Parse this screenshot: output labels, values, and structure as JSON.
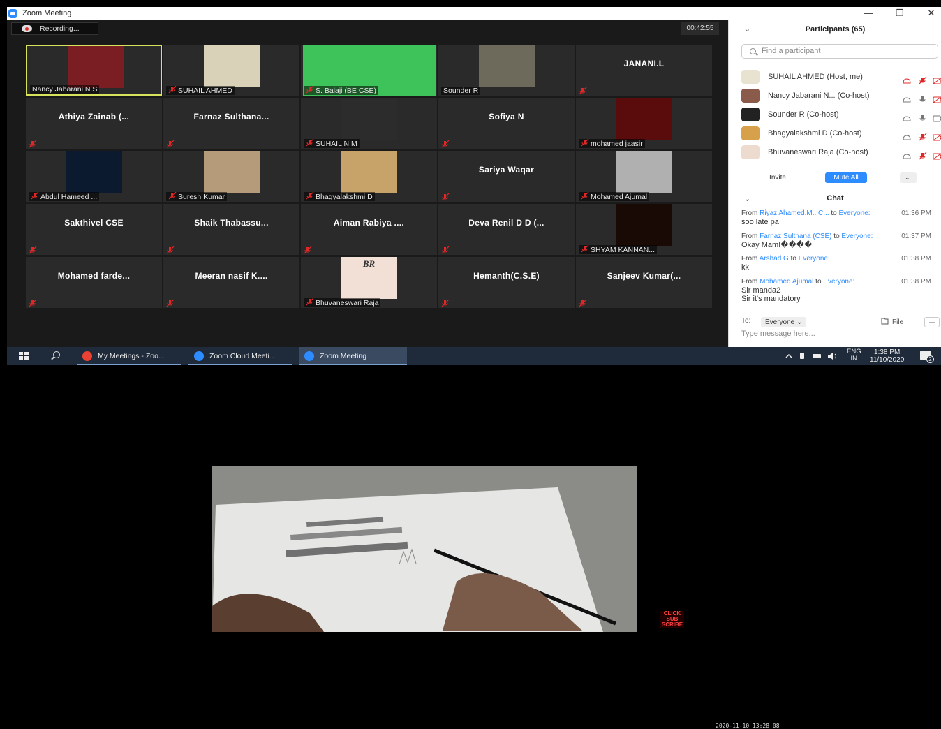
{
  "window": {
    "title": "Zoom Meeting",
    "minimize": "—",
    "restore": "❐",
    "close": "✕"
  },
  "meeting": {
    "recording_label": "Recording...",
    "timer": "00:42:55"
  },
  "tiles": [
    {
      "text": "Nancy Jabarani N S",
      "has_photo": true,
      "muted": false,
      "active": true
    },
    {
      "text": "SUHAIL AHMED",
      "has_photo": true,
      "muted": true
    },
    {
      "text": "S. Balaji (BE CSE)",
      "has_photo": true,
      "muted": true
    },
    {
      "text": "Sounder R",
      "has_photo": true,
      "muted": false
    },
    {
      "text": "JANANI.L",
      "has_photo": false,
      "muted": true
    },
    {
      "text": "Athiya Zainab (...",
      "has_photo": false,
      "muted": true
    },
    {
      "text": "Farnaz Sulthana...",
      "has_photo": false,
      "muted": true
    },
    {
      "text": "SUHAIL N.M",
      "has_photo": true,
      "muted": true
    },
    {
      "text": "Sofiya N",
      "has_photo": false,
      "muted": true
    },
    {
      "text": "mohamed jaasir",
      "has_photo": true,
      "muted": true
    },
    {
      "text": "Abdul Hameed ...",
      "has_photo": true,
      "muted": true
    },
    {
      "text": "Suresh Kumar",
      "has_photo": true,
      "muted": true
    },
    {
      "text": "Bhagyalakshmi D",
      "has_photo": true,
      "muted": true
    },
    {
      "text": "Sariya Waqar",
      "has_photo": false,
      "muted": true
    },
    {
      "text": "Mohamed Ajumal",
      "has_photo": true,
      "muted": true
    },
    {
      "text": "Sakthivel CSE",
      "has_photo": false,
      "muted": true
    },
    {
      "text": "Shaik Thabassu...",
      "has_photo": false,
      "muted": true
    },
    {
      "text": "Aiman Rabiya ....",
      "has_photo": false,
      "muted": true
    },
    {
      "text": "Deva Renil D D (...",
      "has_photo": false,
      "muted": true
    },
    {
      "text": "SHYAM KANNAN...",
      "has_photo": true,
      "muted": true
    },
    {
      "text": "Mohamed farde...",
      "has_photo": false,
      "muted": true
    },
    {
      "text": "Meeran nasif K....",
      "has_photo": false,
      "muted": true
    },
    {
      "text": "Bhuvaneswari Raja",
      "has_photo": true,
      "muted": true,
      "photo_text": "BR"
    },
    {
      "text": "Hemanth(C.S.E)",
      "has_photo": false,
      "muted": true
    },
    {
      "text": "Sanjeev Kumar(...",
      "has_photo": false,
      "muted": true
    }
  ],
  "participants": {
    "header": "Participants (65)",
    "search_placeholder": "Find a participant",
    "rows": [
      {
        "name": "SUHAIL AHMED (Host, me)",
        "mic": "muted",
        "video": "off"
      },
      {
        "name": "Nancy Jabarani N... (Co-host)",
        "mic": "on",
        "video": "off"
      },
      {
        "name": "Sounder R (Co-host)",
        "mic": "on",
        "video": "on"
      },
      {
        "name": "Bhagyalakshmi D (Co-host)",
        "mic": "muted",
        "video": "off"
      },
      {
        "name": "Bhuvaneswari Raja (Co-host)",
        "mic": "muted",
        "video": "off"
      }
    ],
    "invite": "Invite",
    "mute_all": "Mute All",
    "more": "..."
  },
  "chat": {
    "header": "Chat",
    "messages": [
      {
        "from_label": "From",
        "sender": "Riyaz Ahamed.M.. C...",
        "to_label": "to",
        "target": "Everyone:",
        "time": "01:36 PM",
        "lines": [
          "soo late pa"
        ]
      },
      {
        "from_label": "From",
        "sender": "Farnaz Sulthana (CSE)",
        "to_label": "to",
        "target": "Everyone:",
        "time": "01:37 PM",
        "lines": [
          "Okay Mam!����"
        ]
      },
      {
        "from_label": "From",
        "sender": "Arshad G",
        "to_label": "to",
        "target": "Everyone:",
        "time": "01:38 PM",
        "lines": [
          "kk"
        ]
      },
      {
        "from_label": "From",
        "sender": "Mohamed Ajumal",
        "to_label": "to",
        "target": "Everyone:",
        "time": "01:38 PM",
        "lines": [
          "Sir manda2",
          "Sir it's mandatory"
        ]
      }
    ],
    "to_label": "To:",
    "to_value": "Everyone ⌄",
    "file_label": "File",
    "file_more": "···",
    "input_placeholder": "Type message here..."
  },
  "taskbar": {
    "items": [
      {
        "label": "My Meetings - Zoo...",
        "color": "#e94235"
      },
      {
        "label": "Zoom Cloud Meeti...",
        "color": "#2d8cff"
      },
      {
        "label": "Zoom Meeting",
        "color": "#2d8cff"
      }
    ],
    "lang_top": "ENG",
    "lang_bottom": "IN",
    "time": "1:38 PM",
    "date": "11/10/2020",
    "notifications": "2"
  },
  "video": {
    "watermark": "CLICK SUB SCRIBE",
    "timestamp": "2020-11-10 13:28:08"
  }
}
